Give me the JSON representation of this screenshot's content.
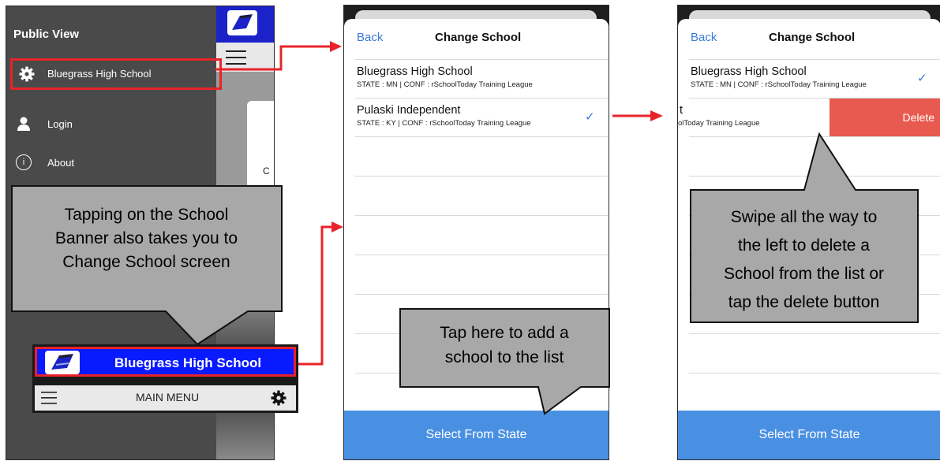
{
  "panel1": {
    "title": "Public View",
    "school_item": "Bluegrass High School",
    "login": "Login",
    "about": "About",
    "partial_letter": "C",
    "info_glyph": "i",
    "icons": [
      "gear-icon",
      "person-icon",
      "info-icon"
    ]
  },
  "callout1": {
    "lines": [
      "Tapping on the School",
      "Banner also takes you to",
      "Change School screen"
    ]
  },
  "banner": {
    "school_name": "Bluegrass High School",
    "menu_label": "MAIN MENU"
  },
  "phone2": {
    "back": "Back",
    "title": "Change School",
    "schools": [
      {
        "name": "Bluegrass High School",
        "meta": "STATE : MN | CONF : rSchoolToday Training League",
        "checked": false
      },
      {
        "name": "Pulaski Independent",
        "meta": "STATE : KY | CONF : rSchoolToday Training League",
        "checked": true
      }
    ],
    "check_glyph": "✓",
    "footer": "Select From State"
  },
  "callout2": {
    "lines": [
      "Tap here to add a",
      "school to the list"
    ]
  },
  "phone3": {
    "back": "Back",
    "title": "Change School",
    "school": {
      "name": "Bluegrass High School",
      "meta": "STATE : MN | CONF : rSchoolToday Training League"
    },
    "swiped": {
      "name": "t",
      "meta": "olToday Training League"
    },
    "delete_label": "Delete",
    "check_glyph": "✓",
    "footer": "Select From State"
  },
  "callout3": {
    "lines": [
      "Swipe all the way to",
      "the left to delete a",
      "School from the list or",
      "tap the delete button"
    ]
  },
  "colors": {
    "highlight_red": "#e8232a",
    "banner_blue": "#0a1aff",
    "footer_blue": "#4a90e2",
    "delete_red": "#e85a4f",
    "callout_gray": "#a8a8a8"
  }
}
